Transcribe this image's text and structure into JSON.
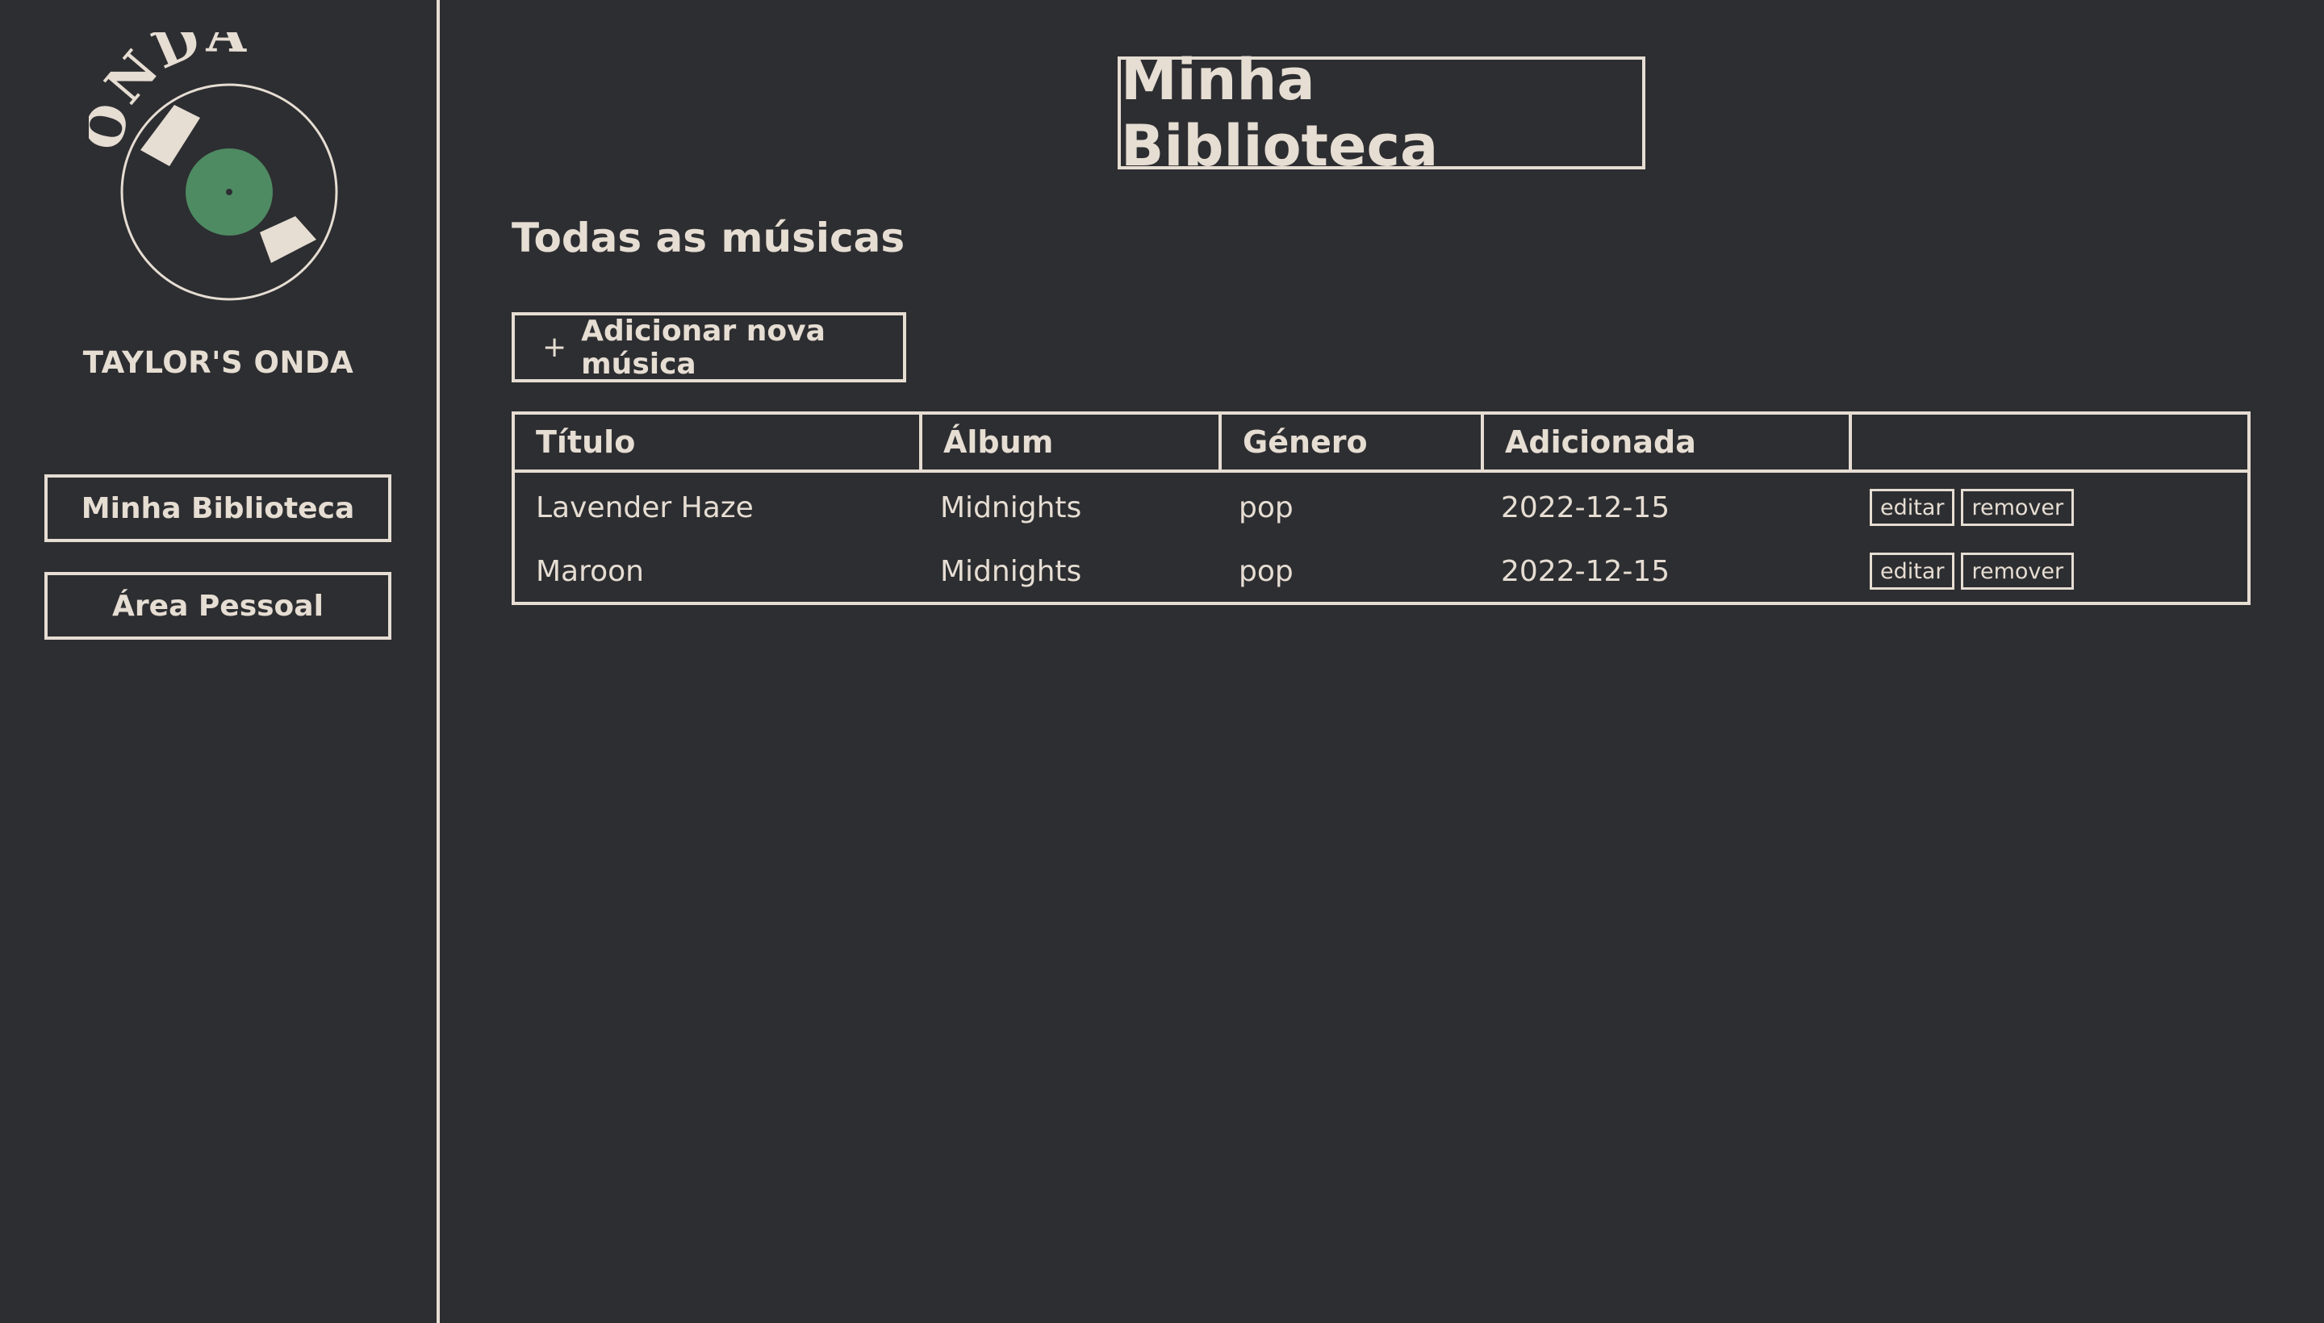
{
  "sidebar": {
    "logo": {
      "text": "ONDA",
      "icon": "vinyl-record-icon",
      "label_color": "#4e8a62"
    },
    "brand": "TAYLOR'S ONDA",
    "nav": [
      {
        "label": "Minha Biblioteca"
      },
      {
        "label": "Área Pessoal"
      }
    ]
  },
  "main": {
    "title": "Minha Biblioteca",
    "section_title": "Todas as músicas",
    "add_button": {
      "icon": "+",
      "label": "Adicionar nova música"
    },
    "table": {
      "headers": [
        "Título",
        "Álbum",
        "Género",
        "Adicionada",
        ""
      ],
      "rows": [
        {
          "title": "Lavender Haze",
          "album": "Midnights",
          "genre": "pop",
          "added": "2022-12-15",
          "edit": "editar",
          "remove": "remover"
        },
        {
          "title": "Maroon",
          "album": "Midnights",
          "genre": "pop",
          "added": "2022-12-15",
          "edit": "editar",
          "remove": "remover"
        }
      ]
    }
  },
  "colors": {
    "background": "#2d2e31",
    "foreground": "#e6ddd3",
    "accent": "#4e8a62"
  }
}
